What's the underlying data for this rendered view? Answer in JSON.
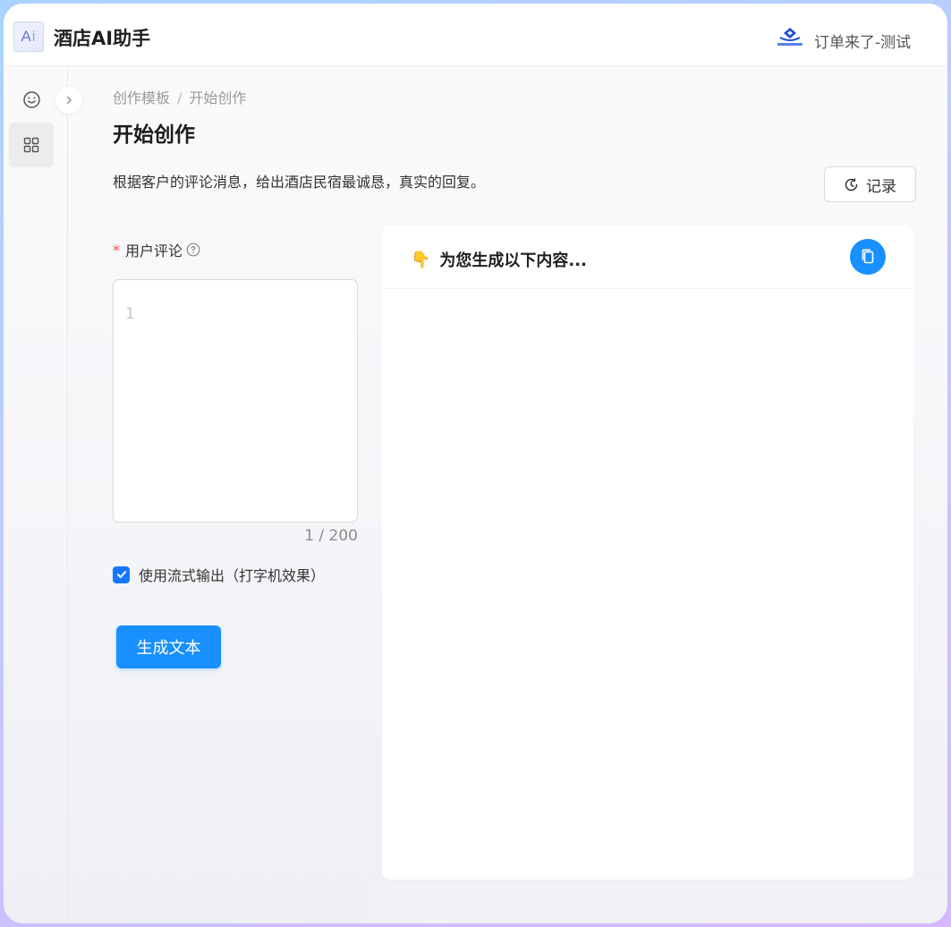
{
  "header": {
    "logo_text": "A",
    "logo_text_2": "i",
    "app_title": "酒店AI助手",
    "brand_name": "订单来了-测试"
  },
  "sidebar": {
    "items": [
      {
        "icon": "smile-icon"
      },
      {
        "icon": "grid-icon"
      }
    ]
  },
  "breadcrumb": {
    "items": [
      "创作模板",
      "开始创作"
    ],
    "separator": "/"
  },
  "page": {
    "title": "开始创作",
    "description": "根据客户的评论消息，给出酒店民宿最诚恳，真实的回复。",
    "history_label": "记录"
  },
  "form": {
    "label": "用户评论",
    "required_mark": "*",
    "input_value": "1",
    "counter": "1 / 200",
    "stream_label": "使用流式输出（打字机效果）",
    "stream_checked": true,
    "submit_label": "生成文本"
  },
  "output": {
    "title": "为您生成以下内容...",
    "title_icon": "👇"
  },
  "colors": {
    "primary": "#1890ff",
    "required": "#ff4d4f"
  }
}
